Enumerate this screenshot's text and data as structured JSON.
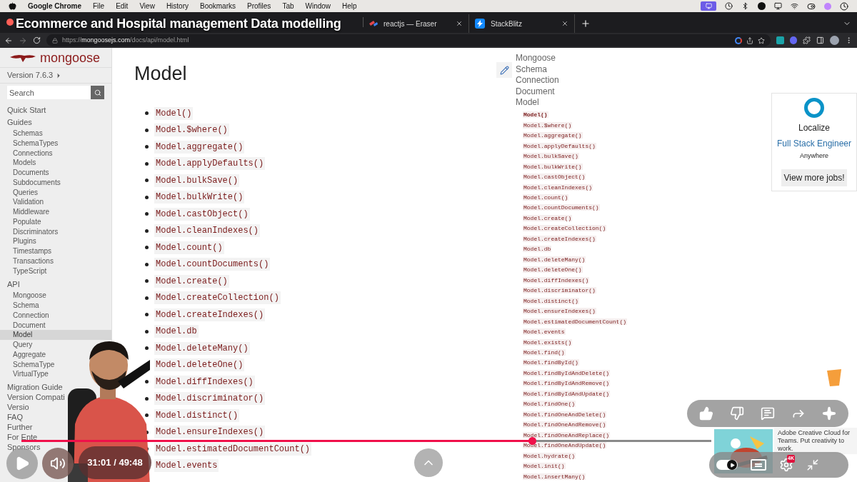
{
  "menu_bar": {
    "app": "Google Chrome",
    "items": [
      "File",
      "Edit",
      "View",
      "History",
      "Bookmarks",
      "Profiles",
      "Tab",
      "Window",
      "Help"
    ]
  },
  "video_title": "Ecommerce and Hospital management Data modelling",
  "tabs": [
    {
      "label": "reactjs — Eraser",
      "kind": "eraser"
    },
    {
      "label": "StackBlitz",
      "kind": "stackblitz"
    }
  ],
  "address_bar": {
    "scheme": "https://",
    "domain": "mongoosejs.com",
    "path": "/docs/api/model.html"
  },
  "sidebar": {
    "logo": "mongoose",
    "version": "Version 7.6.3",
    "search_placeholder": "Search",
    "sections": [
      {
        "label": "Quick Start"
      },
      {
        "label": "Guides",
        "children": [
          {
            "label": "Schemas",
            "selected": false
          },
          {
            "label": "SchemaTypes",
            "selected": false
          },
          {
            "label": "Connections",
            "selected": false
          },
          {
            "label": "Models",
            "selected": false
          },
          {
            "label": "Documents",
            "selected": false
          },
          {
            "label": "Subdocuments",
            "selected": false
          },
          {
            "label": "Queries",
            "selected": false
          },
          {
            "label": "Validation",
            "selected": false
          },
          {
            "label": "Middleware",
            "selected": false
          },
          {
            "label": "Populate",
            "selected": false
          },
          {
            "label": "Discriminators",
            "selected": false
          },
          {
            "label": "Plugins",
            "selected": false
          },
          {
            "label": "Timestamps",
            "selected": false
          },
          {
            "label": "Transactions",
            "selected": false
          },
          {
            "label": "TypeScript",
            "selected": false
          }
        ]
      },
      {
        "label": "API",
        "children": [
          {
            "label": "Mongoose",
            "selected": false
          },
          {
            "label": "Schema",
            "selected": false
          },
          {
            "label": "Connection",
            "selected": false
          },
          {
            "label": "Document",
            "selected": false
          },
          {
            "label": "Model",
            "selected": true
          },
          {
            "label": "Query",
            "selected": false
          },
          {
            "label": "Aggregate",
            "selected": false
          },
          {
            "label": "SchemaType",
            "selected": false
          },
          {
            "label": "VirtualType",
            "selected": false
          }
        ]
      },
      {
        "label": "Migration Guide"
      },
      {
        "label": "Version Compati"
      },
      {
        "label": "Versio"
      },
      {
        "label": "FAQ"
      },
      {
        "label": "Further"
      },
      {
        "label": "For Ente"
      },
      {
        "label": "Sponsors"
      }
    ]
  },
  "page": {
    "title": "Model",
    "methods": [
      "Model()",
      "Model.$where()",
      "Model.aggregate()",
      "Model.applyDefaults()",
      "Model.bulkSave()",
      "Model.bulkWrite()",
      "Model.castObject()",
      "Model.cleanIndexes()",
      "Model.count()",
      "Model.countDocuments()",
      "Model.create()",
      "Model.createCollection()",
      "Model.createIndexes()",
      "Model.db",
      "Model.deleteMany()",
      "Model.deleteOne()",
      "Model.diffIndexes()",
      "Model.discriminator()",
      "Model.distinct()",
      "Model.ensureIndexes()",
      "Model.estimatedDocumentCount()",
      "Model.events"
    ]
  },
  "toc": {
    "sections": [
      "Mongoose",
      "Schema",
      "Connection",
      "Document",
      "Model"
    ],
    "methods": [
      {
        "label": "Model()",
        "selected": true
      },
      {
        "label": "Model.$where()",
        "selected": false
      },
      {
        "label": "Model.aggregate()",
        "selected": false
      },
      {
        "label": "Model.applyDefaults()",
        "selected": false
      },
      {
        "label": "Model.bulkSave()",
        "selected": false
      },
      {
        "label": "Model.bulkWrite()",
        "selected": false
      },
      {
        "label": "Model.castObject()",
        "selected": false
      },
      {
        "label": "Model.cleanIndexes()",
        "selected": false
      },
      {
        "label": "Model.count()",
        "selected": false
      },
      {
        "label": "Model.countDocuments()",
        "selected": false
      },
      {
        "label": "Model.create()",
        "selected": false
      },
      {
        "label": "Model.createCollection()",
        "selected": false
      },
      {
        "label": "Model.createIndexes()",
        "selected": false
      },
      {
        "label": "Model.db",
        "selected": false
      },
      {
        "label": "Model.deleteMany()",
        "selected": false
      },
      {
        "label": "Model.deleteOne()",
        "selected": false
      },
      {
        "label": "Model.diffIndexes()",
        "selected": false
      },
      {
        "label": "Model.discriminator()",
        "selected": false
      },
      {
        "label": "Model.distinct()",
        "selected": false
      },
      {
        "label": "Model.ensureIndexes()",
        "selected": false
      },
      {
        "label": "Model.estimatedDocumentCount()",
        "selected": false
      },
      {
        "label": "Model.events",
        "selected": false
      },
      {
        "label": "Model.exists()",
        "selected": false
      },
      {
        "label": "Model.find()",
        "selected": false
      },
      {
        "label": "Model.findById()",
        "selected": false
      },
      {
        "label": "Model.findByIdAndDelete()",
        "selected": false
      },
      {
        "label": "Model.findByIdAndRemove()",
        "selected": false
      },
      {
        "label": "Model.findByIdAndUpdate()",
        "selected": false
      },
      {
        "label": "Model.findOne()",
        "selected": false
      },
      {
        "label": "Model.findOneAndDelete()",
        "selected": false
      },
      {
        "label": "Model.findOneAndRemove()",
        "selected": false
      },
      {
        "label": "Model.findOneAndReplace()",
        "selected": false
      },
      {
        "label": "Model.findOneAndUpdate()",
        "selected": false
      },
      {
        "label": "Model.hydrate()",
        "selected": false
      },
      {
        "label": "Model.init()",
        "selected": false
      },
      {
        "label": "Model.insertMany()",
        "selected": false
      }
    ]
  },
  "job_ad": {
    "company": "Localize",
    "role": "Full Stack Engineer",
    "location": "Anywhere",
    "button": "View more jobs!"
  },
  "player": {
    "time": "31:01 / 49:48",
    "level": 0.74,
    "autoplay_on": true,
    "quality_badge": "4K",
    "ad_text": "Adobe Creative Cloud for Teams. Put creativity to work."
  }
}
